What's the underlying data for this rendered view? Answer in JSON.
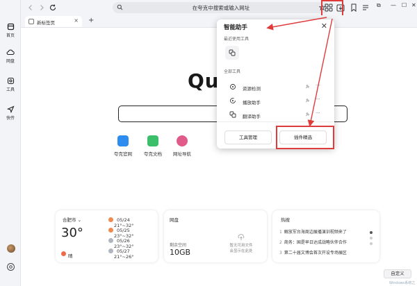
{
  "sidebar": {
    "items": [
      {
        "label": "首页",
        "icon": "home-icon"
      },
      {
        "label": "网盘",
        "icon": "cloud-icon"
      },
      {
        "label": "工具",
        "icon": "tools-icon"
      },
      {
        "label": "快传",
        "icon": "send-icon"
      }
    ]
  },
  "address_bar": {
    "placeholder": "在夸克中搜索或输入网址"
  },
  "tab": {
    "title": "新标签页"
  },
  "main": {
    "logo_text": "Qu",
    "shortcuts": [
      {
        "label": "夸克官网",
        "color": "#2d8cf0"
      },
      {
        "label": "夸克文档",
        "color": "#3cbf6a"
      },
      {
        "label": "网址导航",
        "color": "#e05a8a"
      }
    ]
  },
  "weather": {
    "city": "合肥市",
    "temperature": "30°",
    "condition": "晴",
    "forecast": [
      {
        "date": "05/24",
        "range": "21°~32°",
        "color": "#f08a50"
      },
      {
        "date": "05/25",
        "range": "23°~32°",
        "color": "#f08a50"
      },
      {
        "date": "05/26",
        "range": "23°~32°",
        "color": "#b0b6c0"
      },
      {
        "date": "05/27",
        "range": "21°~26°",
        "color": "#b0b6c0"
      }
    ]
  },
  "netdisk": {
    "title": "网盘",
    "space_label": "剩余空间",
    "space_value": "10GB",
    "message_line1": "暂无可用文件",
    "message_line2": "会显示在此处"
  },
  "hot": {
    "title": "热搜",
    "items": [
      {
        "n": "1",
        "text": "解放军台海周边展播演训视频来了"
      },
      {
        "n": "2",
        "text": "商务：国是早日达成战略伙伴合作"
      },
      {
        "n": "3",
        "text": "第二十届文博会首次开设专场展区"
      }
    ]
  },
  "customize_label": "自定义",
  "watermark": "Windows系统之家",
  "popup": {
    "title": "智能助手",
    "recent_label": "最近使用工具",
    "all_label": "全部工具",
    "tools": [
      {
        "label": "资源检测",
        "icon": "detect-icon"
      },
      {
        "label": "播放助手",
        "icon": "play-icon"
      },
      {
        "label": "翻译助手",
        "icon": "translate-icon"
      }
    ],
    "manage_label": "工具管理",
    "plugins_label": "插件精选"
  },
  "colors": {
    "highlight": "#e03b3b"
  }
}
